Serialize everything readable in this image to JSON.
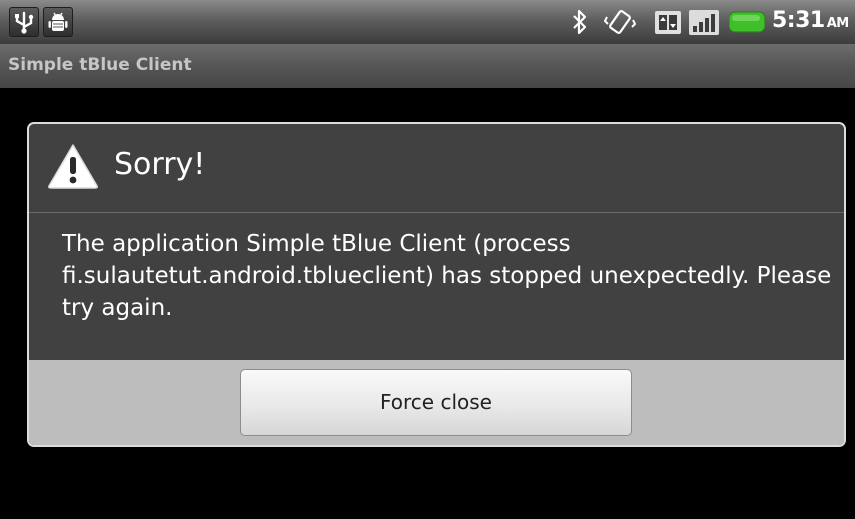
{
  "status_bar": {
    "left_icons": [
      "usb-icon",
      "android-debug-icon"
    ],
    "right_icons": [
      "bluetooth-icon",
      "vibrate-icon",
      "data-transfer-icon",
      "signal-icon",
      "battery-icon"
    ],
    "time": "5:31",
    "ampm": "AM"
  },
  "title_bar": {
    "title": "Simple tBlue Client"
  },
  "dialog": {
    "icon": "warning-icon",
    "title": "Sorry!",
    "message": "The application Simple tBlue Client (process fi.sulautetut.android.tblueclient) has stopped unexpectedly. Please try again.",
    "button_label": "Force close"
  },
  "colors": {
    "dialog_bg": "#414141",
    "dialog_footer": "#bdbdbd",
    "battery": "#3fbf2a"
  }
}
